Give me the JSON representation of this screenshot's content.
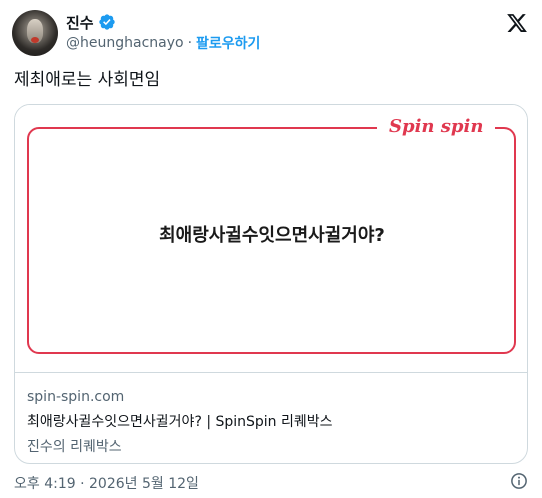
{
  "author": {
    "name": "진수",
    "handle": "@heunghacnayo",
    "separator": "·",
    "follow_label": "팔로우하기"
  },
  "tweet": {
    "text": "제최애로는 사회면임",
    "timestamp": "오후 4:19 · 2026년 5월 12일"
  },
  "card": {
    "brand": "Spin spin",
    "question": "최애랑사귈수잇으면사귈거야?",
    "domain": "spin-spin.com",
    "title": "최애랑사귈수잇으면사귈거야? | SpinSpin 리퀘박스",
    "description": "진수의 리퀘박스"
  },
  "colors": {
    "accent_blue": "#1d9bf0",
    "brand_red": "#e0384f",
    "secondary_text": "#536471"
  },
  "icons": [
    "verified-badge-icon",
    "x-logo-icon",
    "info-icon"
  ]
}
